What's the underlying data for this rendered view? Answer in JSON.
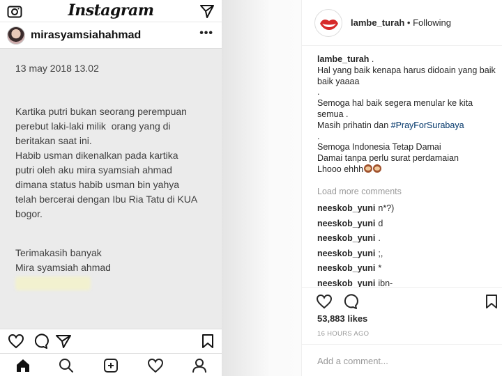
{
  "phone": {
    "logo_text": "Instagram",
    "username": "mirasyamsiahahmad",
    "more_label": "•••",
    "post_image": {
      "date_line": "13 may 2018 13.02",
      "body": "Kartika putri bukan seorang perempuan\nperebut laki-laki milik  orang yang di\nberitakan saat ini.\nHabib usman dikenalkan pada kartika\nputri oleh aku mira syamsiah ahmad\ndimana status habib usman bin yahya\ntelah bercerai dengan Ibu Ria Tatu di KUA\nbogor.",
      "thanks": "Terimakasih banyak\nMira syamsiah ahmad"
    }
  },
  "sidebar": {
    "header": {
      "username": "lambe_turah",
      "separator": " • ",
      "follow_status": "Following",
      "avatar_icon": "lips-logo-icon"
    },
    "caption": {
      "username": "lambe_turah",
      "lines": [
        " .",
        "Hal yang baik kenapa harus didoain yang baik baik yaaaa",
        ".",
        "Semoga hal baik segera menular ke kita semua .",
        "Masih prihatin dan ",
        ".",
        "Semoga Indonesia Tetap Damai",
        "Damai tanpa perlu surat perdamaian",
        "Lhooo ehhh"
      ],
      "hashtag": "#PrayForSurabaya"
    },
    "load_more": "Load more comments",
    "comments": [
      {
        "user": "neeskob_yuni",
        "text": "n*?)"
      },
      {
        "user": "neeskob_yuni",
        "text": "d"
      },
      {
        "user": "neeskob_yuni",
        "text": "."
      },
      {
        "user": "neeskob_yuni",
        "text": ";,"
      },
      {
        "user": "neeskob_yuni",
        "text": "*"
      },
      {
        "user": "neeskob_yuni",
        "text": "ibn-"
      }
    ],
    "likes": "53,883 likes",
    "time_ago": "16 HOURS AGO",
    "add_comment_placeholder": "Add a comment..."
  },
  "colors": {
    "hashtag": "#003569",
    "muted": "#999999",
    "text": "#262626"
  }
}
